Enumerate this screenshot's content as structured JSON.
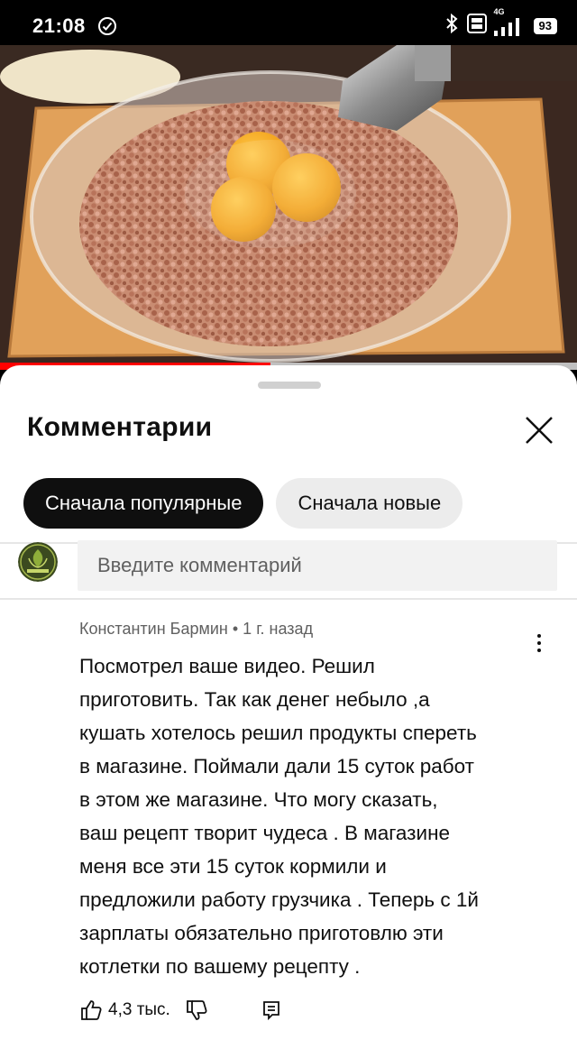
{
  "status_bar": {
    "time": "21:08",
    "network": "4G",
    "battery": "93",
    "icons": [
      "check-circle-icon",
      "bluetooth-icon",
      "volte-icon",
      "signal-icon",
      "battery-icon"
    ]
  },
  "video": {
    "description_icon": "video-thumbnail"
  },
  "sheet": {
    "title": "Комментарии",
    "close_icon": "close-icon",
    "sort_chips": [
      "Сначала популярные",
      "Сначала новые"
    ],
    "active_chip_index": 0
  },
  "comment_input": {
    "placeholder": "Введите комментарий"
  },
  "comments": [
    {
      "author": "Константин Бармин",
      "time": "1 г. назад",
      "meta": "Константин Бармин • 1 г. назад",
      "text": "Посмотрел ваше видео.  Решил\nприготовить.  Так как денег небыло ,а\nкушать хотелось  решил продукты спереть\nв магазине.  Поймали дали 15 суток работ\nв этом же магазине.  Что могу сказать,\nваш рецепт  творит  чудеса . В магазине\nменя все эти 15 суток кормили и\nпредложили работу  грузчика . Теперь с 1й\nзарплаты  обязательно  приготовлю эти\nкотлетки по вашему  рецепту .",
      "likes": "4,3 тыс."
    }
  ],
  "colors": {
    "active_chip_bg": "#0f0f0f",
    "inactive_chip_bg": "#ececec",
    "text_primary": "#0f0f0f",
    "text_secondary": "#606060"
  }
}
